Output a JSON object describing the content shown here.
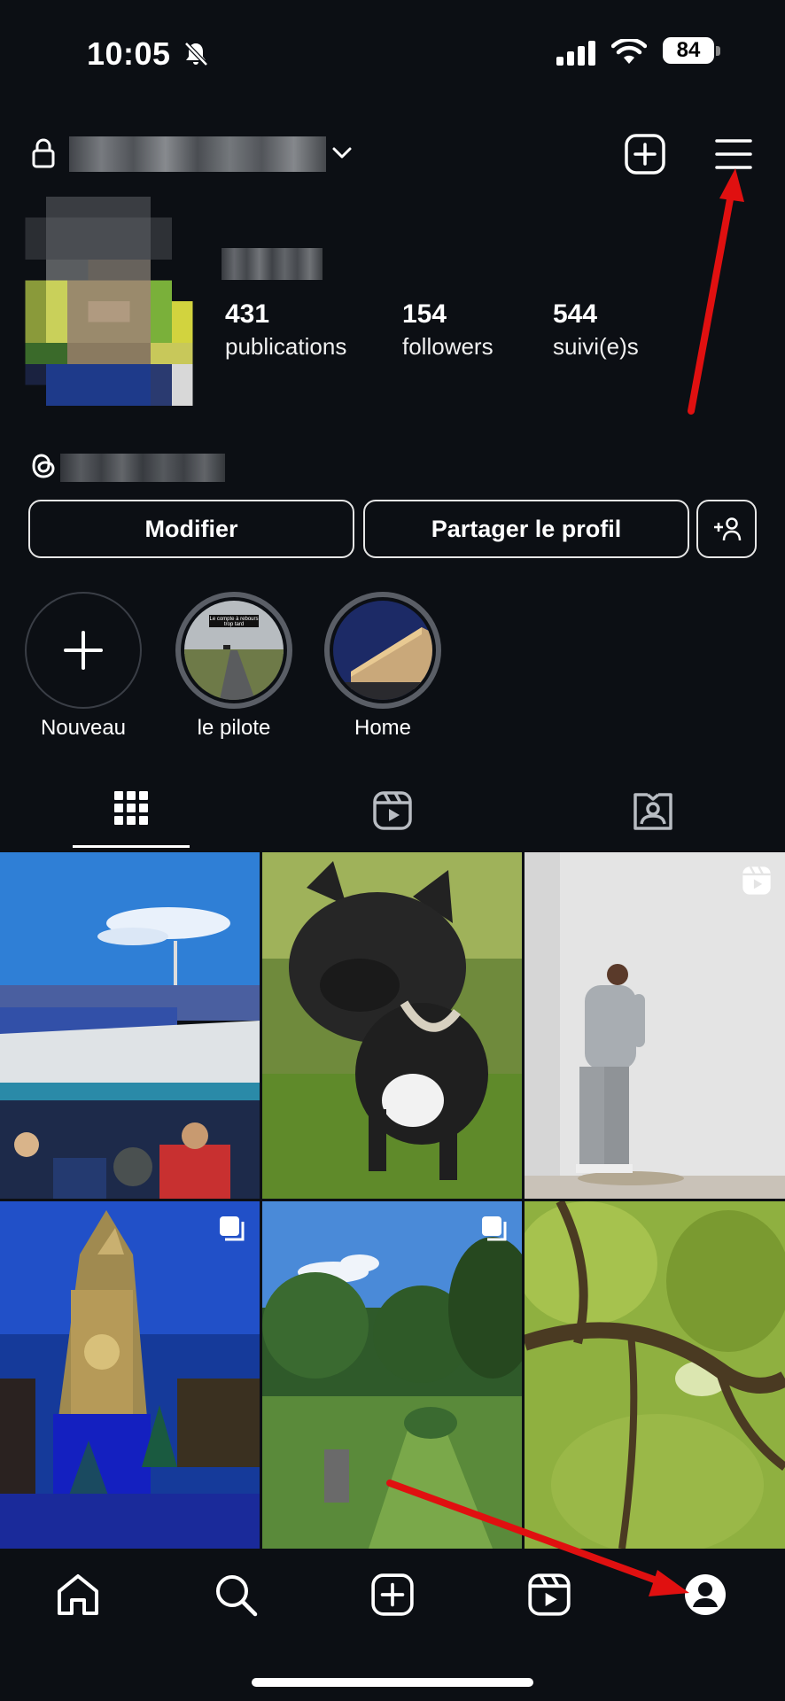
{
  "status_bar": {
    "time": "10:05",
    "battery": "84"
  },
  "profile": {
    "posts_count": "431",
    "posts_label": "publications",
    "followers_count": "154",
    "followers_label": "followers",
    "following_count": "544",
    "following_label": "suivi(e)s"
  },
  "actions": {
    "edit_label": "Modifier",
    "share_label": "Partager le profil"
  },
  "highlights": [
    {
      "label": "Nouveau"
    },
    {
      "label": "le pilote",
      "cover_text": "Le compte à rebours trop tard"
    },
    {
      "label": "Home"
    }
  ],
  "tabs": [
    "grid-icon",
    "reels-icon",
    "tagged-icon"
  ],
  "nav": [
    "home-icon",
    "search-icon",
    "create-icon",
    "reels-icon",
    "profile-icon"
  ],
  "colors": {
    "background": "#0c0f14",
    "annotation_arrow": "#e01010",
    "ring_highlight": "#5a5e66"
  }
}
